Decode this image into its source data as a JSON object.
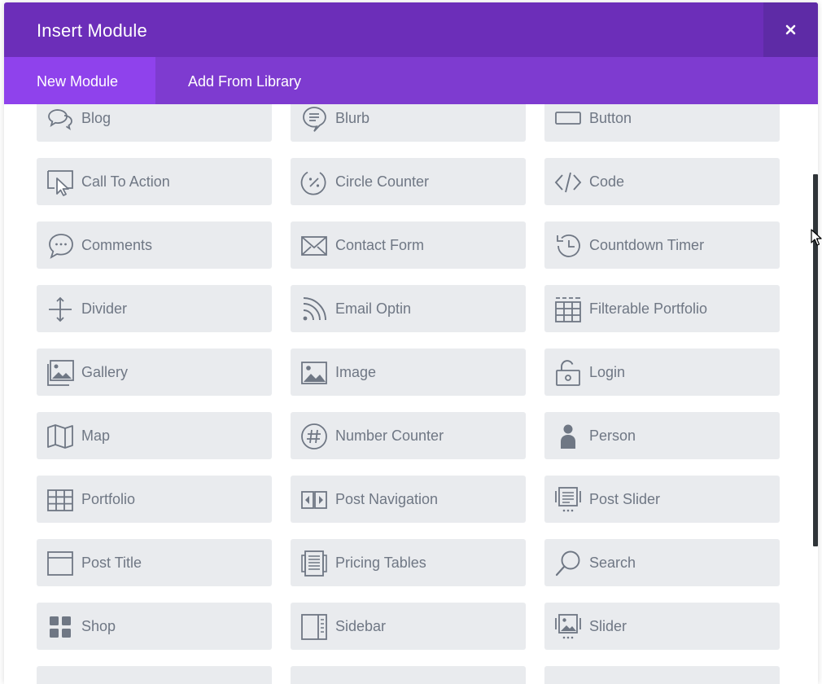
{
  "dialog": {
    "title": "Insert Module",
    "close_symbol": "×",
    "accent_header": "#6c2eb9",
    "accent_tabs": "#7e3bd0",
    "accent_active_tab": "#8f42ec"
  },
  "tabs": [
    {
      "label": "New Module",
      "active": true
    },
    {
      "label": "Add From Library",
      "active": false
    }
  ],
  "modules": [
    {
      "label": "Blog",
      "icon": "blog-icon"
    },
    {
      "label": "Blurb",
      "icon": "blurb-icon"
    },
    {
      "label": "Button",
      "icon": "button-icon"
    },
    {
      "label": "Call To Action",
      "icon": "call-to-action-icon"
    },
    {
      "label": "Circle Counter",
      "icon": "circle-counter-icon"
    },
    {
      "label": "Code",
      "icon": "code-icon"
    },
    {
      "label": "Comments",
      "icon": "comments-icon"
    },
    {
      "label": "Contact Form",
      "icon": "envelope-icon"
    },
    {
      "label": "Countdown Timer",
      "icon": "history-clock-icon"
    },
    {
      "label": "Divider",
      "icon": "divider-icon"
    },
    {
      "label": "Email Optin",
      "icon": "rss-icon"
    },
    {
      "label": "Filterable Portfolio",
      "icon": "filterable-grid-icon"
    },
    {
      "label": "Gallery",
      "icon": "gallery-icon"
    },
    {
      "label": "Image",
      "icon": "image-icon"
    },
    {
      "label": "Login",
      "icon": "unlock-icon"
    },
    {
      "label": "Map",
      "icon": "map-icon"
    },
    {
      "label": "Number Counter",
      "icon": "hash-icon"
    },
    {
      "label": "Person",
      "icon": "person-icon"
    },
    {
      "label": "Portfolio",
      "icon": "grid-icon"
    },
    {
      "label": "Post Navigation",
      "icon": "post-navigation-icon"
    },
    {
      "label": "Post Slider",
      "icon": "post-slider-icon"
    },
    {
      "label": "Post Title",
      "icon": "post-title-icon"
    },
    {
      "label": "Pricing Tables",
      "icon": "pricing-tables-icon"
    },
    {
      "label": "Search",
      "icon": "search-icon"
    },
    {
      "label": "Shop",
      "icon": "shop-icon"
    },
    {
      "label": "Sidebar",
      "icon": "sidebar-icon"
    },
    {
      "label": "Slider",
      "icon": "slider-icon"
    },
    {
      "label": "",
      "icon": ""
    },
    {
      "label": "",
      "icon": ""
    },
    {
      "label": "",
      "icon": ""
    }
  ]
}
